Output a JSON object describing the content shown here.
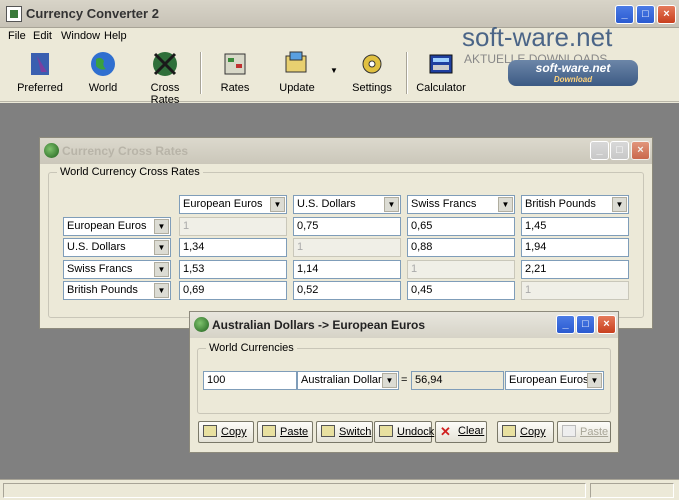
{
  "app": {
    "title": "Currency Converter 2"
  },
  "menu": [
    "File",
    "Edit",
    "Window",
    "Help"
  ],
  "toolbar": {
    "preferred": "Preferred",
    "world": "World",
    "cross": "Cross Rates",
    "rates": "Rates",
    "update": "Update",
    "settings": "Settings",
    "calculator": "Calculator"
  },
  "watermark": {
    "main": "soft-ware.net",
    "sub": "AKTUELLE DOWNLOADS",
    "badge": "soft-ware.net",
    "badge_sub": "Download"
  },
  "cross_window": {
    "title": "Currency Cross Rates",
    "group": "World Currency Cross Rates",
    "cols": [
      "European Euros",
      "U.S. Dollars",
      "Swiss Francs",
      "British Pounds"
    ],
    "rows": [
      {
        "label": "European Euros",
        "values": [
          "1",
          "0,75",
          "0,65",
          "1,45"
        ]
      },
      {
        "label": "U.S. Dollars",
        "values": [
          "1,34",
          "1",
          "0,88",
          "1,94"
        ]
      },
      {
        "label": "Swiss Francs",
        "values": [
          "1,53",
          "1,14",
          "1",
          "2,21"
        ]
      },
      {
        "label": "British Pounds",
        "values": [
          "0,69",
          "0,52",
          "0,45",
          "1"
        ]
      }
    ]
  },
  "conv_window": {
    "title": "Australian Dollars -> European Euros",
    "group": "World Currencies",
    "amount": "100",
    "from": "Australian Dollars",
    "equals": "=",
    "result": "56,94",
    "to": "European Euros",
    "buttons": {
      "copy": "Copy",
      "paste": "Paste",
      "switch": "Switch",
      "undock": "Undock",
      "clear": "Clear",
      "copy2": "Copy",
      "paste2": "Paste"
    }
  },
  "colors": {
    "accent": "#2a5ad0",
    "workspace": "#808080",
    "close": "#c8401e"
  }
}
